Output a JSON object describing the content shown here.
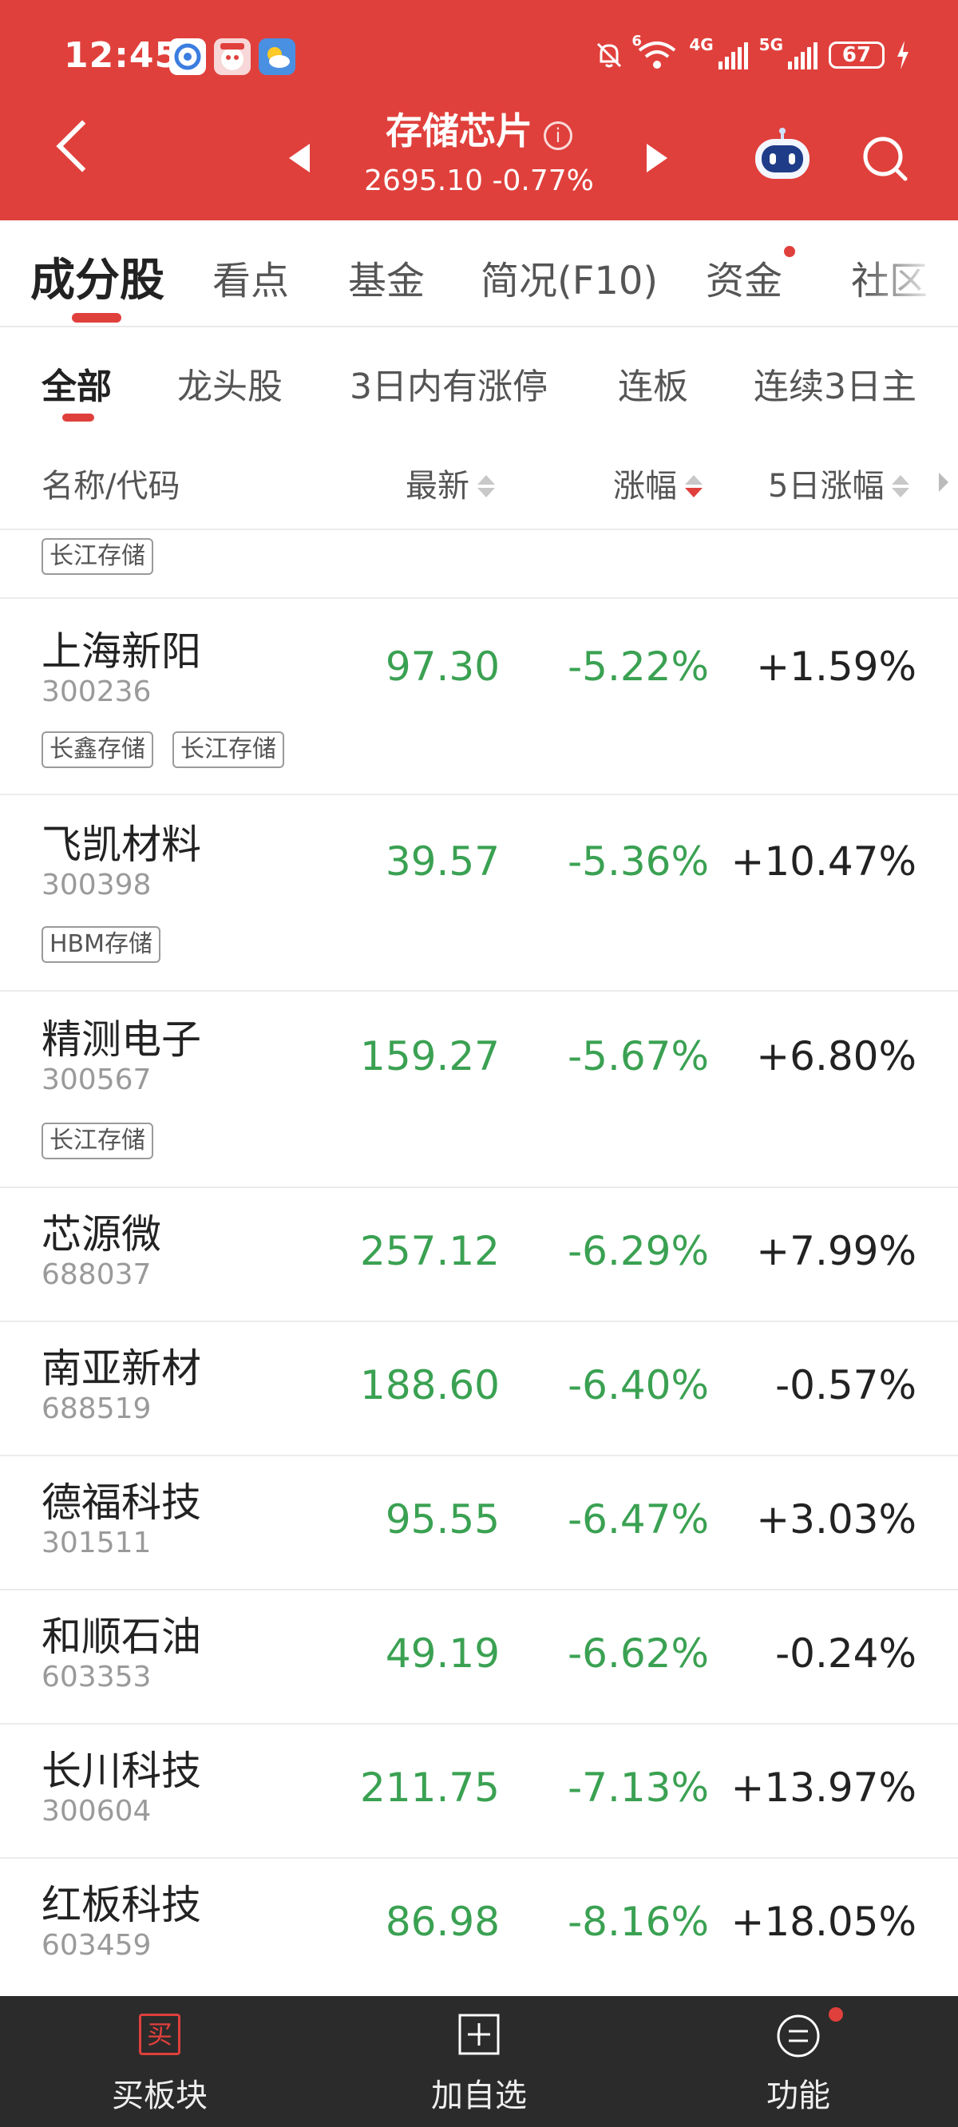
{
  "status_bar": {
    "time": "12:45",
    "battery": "67",
    "network_a": "4G",
    "network_b": "5G",
    "wifi_badge": "6"
  },
  "header": {
    "title": "存储芯片",
    "index_value": "2695.10",
    "index_change": "-0.77%"
  },
  "main_tabs": [
    {
      "label": "成分股",
      "active": true
    },
    {
      "label": "看点"
    },
    {
      "label": "基金"
    },
    {
      "label": "简况(F10)"
    },
    {
      "label": "资金"
    },
    {
      "label": "社区"
    }
  ],
  "sub_tabs": [
    {
      "label": "全部",
      "active": true
    },
    {
      "label": "龙头股"
    },
    {
      "label": "3日内有涨停"
    },
    {
      "label": "连板"
    },
    {
      "label": "连续3日主"
    }
  ],
  "columns": {
    "name": "名称/代码",
    "price": "最新",
    "change": "涨幅",
    "change5d": "5日涨幅"
  },
  "partial_row_tag": "长江存储",
  "stocks": [
    {
      "name": "上海新阳",
      "code": "300236",
      "price": "97.30",
      "change": "-5.22%",
      "change5d": "+1.59%",
      "tags": [
        "长鑫存储",
        "长江存储"
      ]
    },
    {
      "name": "飞凯材料",
      "code": "300398",
      "price": "39.57",
      "change": "-5.36%",
      "change5d": "+10.47%",
      "tags": [
        "HBM存储"
      ]
    },
    {
      "name": "精测电子",
      "code": "300567",
      "price": "159.27",
      "change": "-5.67%",
      "change5d": "+6.80%",
      "tags": [
        "长江存储"
      ]
    },
    {
      "name": "芯源微",
      "code": "688037",
      "price": "257.12",
      "change": "-6.29%",
      "change5d": "+7.99%",
      "tags": []
    },
    {
      "name": "南亚新材",
      "code": "688519",
      "price": "188.60",
      "change": "-6.40%",
      "change5d": "-0.57%",
      "tags": []
    },
    {
      "name": "德福科技",
      "code": "301511",
      "price": "95.55",
      "change": "-6.47%",
      "change5d": "+3.03%",
      "tags": []
    },
    {
      "name": "和顺石油",
      "code": "603353",
      "price": "49.19",
      "change": "-6.62%",
      "change5d": "-0.24%",
      "tags": []
    },
    {
      "name": "长川科技",
      "code": "300604",
      "price": "211.75",
      "change": "-7.13%",
      "change5d": "+13.97%",
      "tags": []
    },
    {
      "name": "红板科技",
      "code": "603459",
      "price": "86.98",
      "change": "-8.16%",
      "change5d": "+18.05%",
      "tags": []
    }
  ],
  "bottom_bar": {
    "buy_label": "买板块",
    "buy_icon_text": "买",
    "add_label": "加自选",
    "func_label": "功能"
  },
  "colors": {
    "brand_red": "#e0403c",
    "down_green": "#3aa152",
    "bottom_bar": "#2b2b2b"
  }
}
